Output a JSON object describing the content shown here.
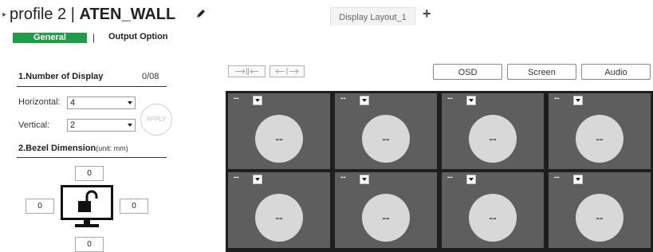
{
  "header": {
    "profile_prefix": "profile 2 | ",
    "wall_name": "ATEN_WALL",
    "expand_arrow": "▸",
    "edit_icon": "pencil-icon",
    "active_tab": "Display Layout_1",
    "add_tab": "+"
  },
  "subtabs": {
    "general": "General",
    "separator": "|",
    "output_option": "Output Option",
    "active_color": "#1f9c45"
  },
  "display_count": {
    "title": "1.Number of Display",
    "count": "0/08"
  },
  "horizontal": {
    "label": "Horizontal:",
    "value": "4"
  },
  "vertical": {
    "label": "Vertical:",
    "value": "2"
  },
  "apply_label": "APPLY",
  "bezel": {
    "title": "2.Bezel Dimension",
    "unit": "(unit: mm)",
    "top": "0",
    "left": "0",
    "right": "0",
    "bottom": "0",
    "lock_icon": "unlock-icon"
  },
  "toolbar": {
    "shrink_icon": "collapse-arrows-icon",
    "expand_icon": "expand-arrows-icon",
    "osd": "OSD",
    "screen": "Screen",
    "audio": "Audio"
  },
  "grid": {
    "cells": [
      {
        "source": "--",
        "label": "--"
      },
      {
        "source": "--",
        "label": "--"
      },
      {
        "source": "--",
        "label": "--"
      },
      {
        "source": "--",
        "label": "--"
      },
      {
        "source": "--",
        "label": "--"
      },
      {
        "source": "--",
        "label": "--"
      },
      {
        "source": "--",
        "label": "--"
      },
      {
        "source": "--",
        "label": "--"
      }
    ]
  }
}
